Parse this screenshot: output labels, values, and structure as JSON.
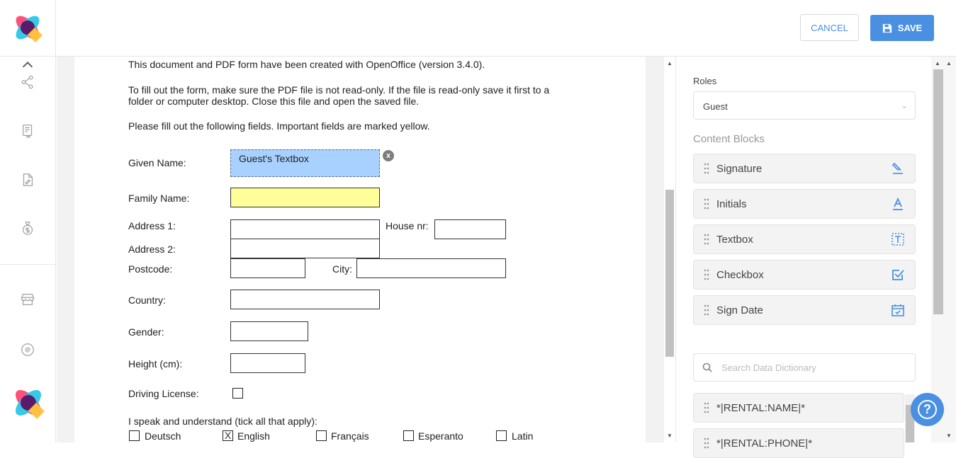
{
  "header": {
    "cancel_label": "CANCEL",
    "save_label": "SAVE"
  },
  "rail": {
    "icons": [
      "chevron-up-icon",
      "share-icon",
      "documents-icon",
      "contract-icon",
      "money-bag-icon",
      "store-icon",
      "integration-icon"
    ]
  },
  "document": {
    "intro_line1": "This document and PDF form have been created with OpenOffice (version 3.4.0).",
    "intro_line2": "To fill out the form, make sure the PDF file is not read-only. If the file is read-only save it first to a",
    "intro_line3": "folder or computer desktop. Close this file and open the saved file.",
    "intro_line4": "Please fill out the following fields. Important fields are marked yellow.",
    "labels": {
      "given_name": "Given Name:",
      "family_name": "Family Name:",
      "address1": "Address 1:",
      "house_nr": "House nr:",
      "address2": "Address 2:",
      "postcode": "Postcode:",
      "city": "City:",
      "country": "Country:",
      "gender": "Gender:",
      "height": "Height (cm):",
      "driving_license": "Driving License:",
      "languages_prompt": "I speak and understand (tick all that apply):"
    },
    "guest_textbox": "Guest's Textbox",
    "close_glyph": "x",
    "languages": [
      {
        "label": "Deutsch",
        "checked": false,
        "mark": ""
      },
      {
        "label": "English",
        "checked": true,
        "mark": "X"
      },
      {
        "label": "Français",
        "checked": false,
        "mark": ""
      },
      {
        "label": "Esperanto",
        "checked": false,
        "mark": ""
      },
      {
        "label": "Latin",
        "checked": false,
        "mark": ""
      }
    ]
  },
  "panel": {
    "roles_label": "Roles",
    "roles_value": "Guest",
    "content_blocks_label": "Content Blocks",
    "blocks": [
      {
        "label": "Signature",
        "icon": "signature-icon"
      },
      {
        "label": "Initials",
        "icon": "initials-icon"
      },
      {
        "label": "Textbox",
        "icon": "textbox-icon"
      },
      {
        "label": "Checkbox",
        "icon": "checkbox-icon"
      },
      {
        "label": "Sign Date",
        "icon": "calendar-icon"
      }
    ],
    "search_placeholder": "Search Data Dictionary",
    "dictionary": [
      "*|RENTAL:NAME|*",
      "*|RENTAL:PHONE|*"
    ]
  },
  "help_glyph": "?",
  "colors": {
    "accent": "#4a90e2",
    "guest_field": "#a8d1ff",
    "required_field": "#ffff99"
  }
}
